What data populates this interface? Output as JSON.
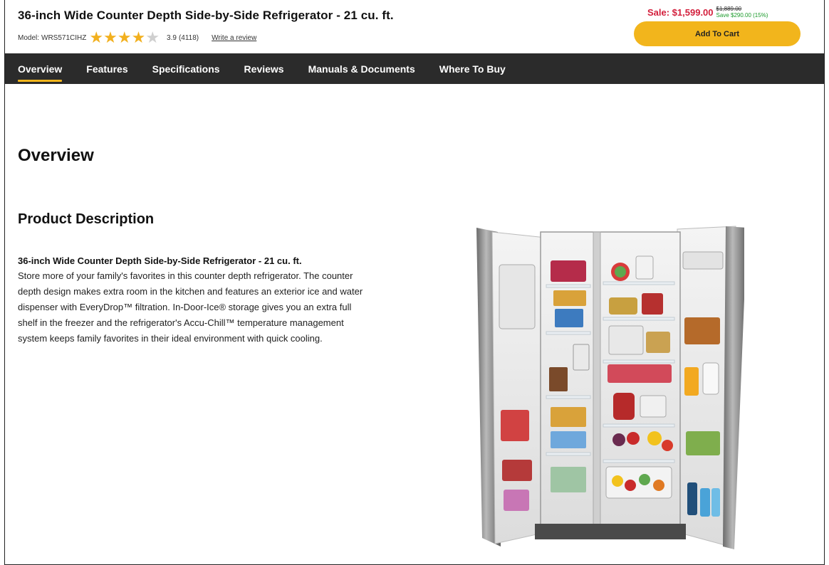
{
  "header": {
    "title": "36-inch Wide Counter Depth Side-by-Side Refrigerator - 21 cu. ft.",
    "model_label": "Model:",
    "model_number": "WRS571CIHZ",
    "rating": "3.9",
    "reviews_count": "(4118)",
    "write_review": "Write a review",
    "stars_filled": 3.9,
    "stars_total": 5
  },
  "price": {
    "sale": "Sale: $1,599.00",
    "original": "$1,889.00",
    "save": "Save $290.00 (15%)"
  },
  "cart": {
    "label": "Add To Cart"
  },
  "nav": {
    "items": [
      {
        "label": "Overview",
        "active": true
      },
      {
        "label": "Features"
      },
      {
        "label": "Specifications"
      },
      {
        "label": "Reviews"
      },
      {
        "label": "Manuals & Documents"
      },
      {
        "label": "Where To Buy"
      }
    ]
  },
  "main": {
    "heading": "Overview",
    "subheading": "Product Description",
    "desc_title": "36-inch Wide Counter Depth Side-by-Side Refrigerator - 21 cu. ft.",
    "desc_text": "Store more of your family's favorites in this counter depth refrigerator. The counter depth design makes extra room in the kitchen and features an exterior ice and water dispenser with EveryDrop™ filtration. In-Door-Ice® storage gives you an extra full shelf in the freezer and the refrigerator's Accu-Chill™ temperature management system keeps family favorites in their ideal environment with quick cooling."
  },
  "colors": {
    "accent": "#f2b51c",
    "nav_bg": "#2b2b2b",
    "sale": "#d31f3c",
    "save": "#1a9a2a"
  }
}
